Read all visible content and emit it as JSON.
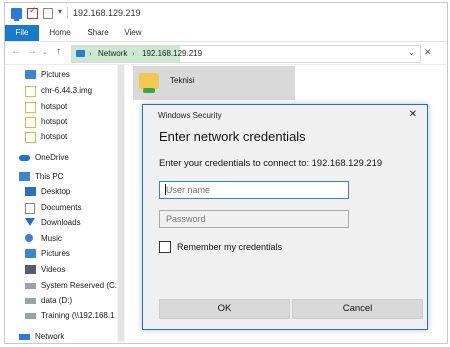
{
  "window": {
    "title": "192.168.129.219",
    "qa_dropdown": "▾"
  },
  "ribbon": {
    "tabs": [
      {
        "label": "File"
      },
      {
        "label": "Home"
      },
      {
        "label": "Share"
      },
      {
        "label": "View"
      }
    ]
  },
  "address": {
    "back": "←",
    "forward": "→",
    "recent": "⌄",
    "up": "↑",
    "separator": "›",
    "segments": [
      "Network",
      "192.168.129.219"
    ],
    "dropdown": "⌄",
    "clear": "✕"
  },
  "nav": {
    "pin": "📌",
    "items": [
      {
        "label": "Pictures",
        "icon": "pictures-icon"
      },
      {
        "label": "chr-6.44.3.img",
        "icon": "folder-icon"
      },
      {
        "label": "hotspot",
        "icon": "folder-icon"
      },
      {
        "label": "hotspot",
        "icon": "folder-icon"
      },
      {
        "label": "hotspot",
        "icon": "folder-icon"
      },
      {
        "label": "OneDrive",
        "icon": "cloud-icon"
      },
      {
        "label": "This PC",
        "icon": "computer-icon"
      },
      {
        "label": "Desktop",
        "icon": "desktop-icon"
      },
      {
        "label": "Documents",
        "icon": "documents-icon"
      },
      {
        "label": "Downloads",
        "icon": "downloads-icon"
      },
      {
        "label": "Music",
        "icon": "music-icon"
      },
      {
        "label": "Pictures",
        "icon": "pictures-icon"
      },
      {
        "label": "Videos",
        "icon": "videos-icon"
      },
      {
        "label": "System Reserved (C:)",
        "icon": "drive-icon"
      },
      {
        "label": "data (D:)",
        "icon": "drive-icon"
      },
      {
        "label": "Training (\\\\192.168.1",
        "icon": "network-drive-icon"
      },
      {
        "label": "Network",
        "icon": "network-icon"
      }
    ]
  },
  "content": {
    "items": [
      {
        "label": "Teknisi"
      }
    ]
  },
  "dialog": {
    "title": "Windows Security",
    "close": "✕",
    "heading": "Enter network credentials",
    "description": "Enter your credentials to connect to: 192.168.129.219",
    "username_placeholder": "User name",
    "password_placeholder": "Password",
    "remember_label": "Remember my credentials",
    "ok_label": "OK",
    "cancel_label": "Cancel"
  },
  "colors": {
    "accent": "#1979ca",
    "address_highlight": "#cce8cf",
    "dialog_border": "#1a74c9"
  }
}
